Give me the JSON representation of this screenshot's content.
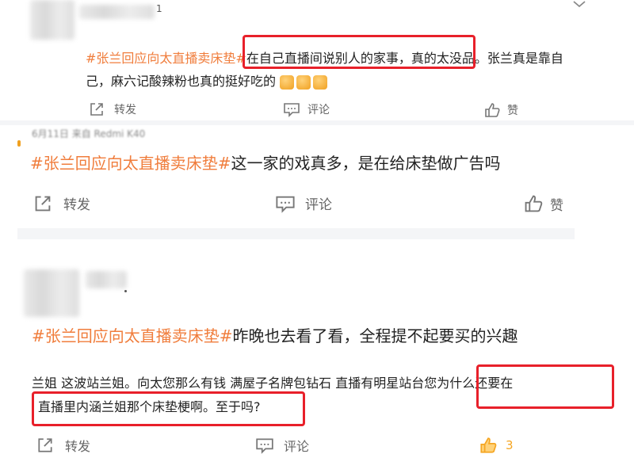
{
  "post1": {
    "header_partial": "1",
    "hashtag": "#张兰回应向太直播卖床垫#",
    "text_line1_highlight": "在自己直播间说别人的家事，真的太没品",
    "text_line1_rest": "。张兰真是靠自",
    "text_line2": "己，麻六记酸辣粉也真的挺好吃的",
    "emoji_count": 3,
    "repost_label": "转发",
    "comment_label": "评论",
    "like_label": "赞"
  },
  "post2": {
    "header_partial": "6月11日 来自 Redmi K40",
    "hashtag": "#张兰回应向太直播卖床垫#",
    "text": "这一家的戏真多，是在给床垫做广告吗",
    "repost_label": "转发",
    "comment_label": "评论",
    "like_label": "赞"
  },
  "post3": {
    "hashtag": "#张兰回应向太直播卖床垫#",
    "text": "昨晚也去看了看，全程提不起要买的兴趣",
    "body_line1_pre": "兰姐 这波站兰姐。向太您那么有钱 满屋子名牌包钻石 直播有明星站台",
    "body_line1_highlight": "您为什么还要在",
    "body_line2_highlight": "直播里内涵兰姐那个床垫梗啊。至于吗?",
    "repost_label": "转发",
    "comment_label": "评论",
    "like_count": "3"
  },
  "colors": {
    "hashtag": "#f07d3c",
    "highlight_box": "#e8202a",
    "like_active": "#f5a623"
  },
  "icons": [
    "repost-icon",
    "comment-icon",
    "like-icon",
    "chevron-down-icon",
    "thumbs-up-emoji"
  ]
}
